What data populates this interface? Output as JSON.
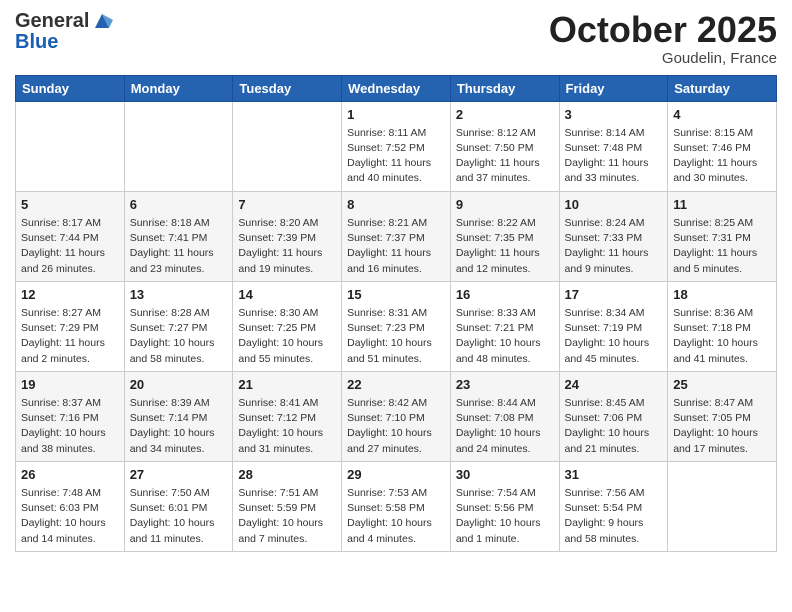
{
  "header": {
    "logo_general": "General",
    "logo_blue": "Blue",
    "month_title": "October 2025",
    "location": "Goudelin, France"
  },
  "days_of_week": [
    "Sunday",
    "Monday",
    "Tuesday",
    "Wednesday",
    "Thursday",
    "Friday",
    "Saturday"
  ],
  "weeks": [
    [
      {
        "day": "",
        "info": ""
      },
      {
        "day": "",
        "info": ""
      },
      {
        "day": "",
        "info": ""
      },
      {
        "day": "1",
        "info": "Sunrise: 8:11 AM\nSunset: 7:52 PM\nDaylight: 11 hours and 40 minutes."
      },
      {
        "day": "2",
        "info": "Sunrise: 8:12 AM\nSunset: 7:50 PM\nDaylight: 11 hours and 37 minutes."
      },
      {
        "day": "3",
        "info": "Sunrise: 8:14 AM\nSunset: 7:48 PM\nDaylight: 11 hours and 33 minutes."
      },
      {
        "day": "4",
        "info": "Sunrise: 8:15 AM\nSunset: 7:46 PM\nDaylight: 11 hours and 30 minutes."
      }
    ],
    [
      {
        "day": "5",
        "info": "Sunrise: 8:17 AM\nSunset: 7:44 PM\nDaylight: 11 hours and 26 minutes."
      },
      {
        "day": "6",
        "info": "Sunrise: 8:18 AM\nSunset: 7:41 PM\nDaylight: 11 hours and 23 minutes."
      },
      {
        "day": "7",
        "info": "Sunrise: 8:20 AM\nSunset: 7:39 PM\nDaylight: 11 hours and 19 minutes."
      },
      {
        "day": "8",
        "info": "Sunrise: 8:21 AM\nSunset: 7:37 PM\nDaylight: 11 hours and 16 minutes."
      },
      {
        "day": "9",
        "info": "Sunrise: 8:22 AM\nSunset: 7:35 PM\nDaylight: 11 hours and 12 minutes."
      },
      {
        "day": "10",
        "info": "Sunrise: 8:24 AM\nSunset: 7:33 PM\nDaylight: 11 hours and 9 minutes."
      },
      {
        "day": "11",
        "info": "Sunrise: 8:25 AM\nSunset: 7:31 PM\nDaylight: 11 hours and 5 minutes."
      }
    ],
    [
      {
        "day": "12",
        "info": "Sunrise: 8:27 AM\nSunset: 7:29 PM\nDaylight: 11 hours and 2 minutes."
      },
      {
        "day": "13",
        "info": "Sunrise: 8:28 AM\nSunset: 7:27 PM\nDaylight: 10 hours and 58 minutes."
      },
      {
        "day": "14",
        "info": "Sunrise: 8:30 AM\nSunset: 7:25 PM\nDaylight: 10 hours and 55 minutes."
      },
      {
        "day": "15",
        "info": "Sunrise: 8:31 AM\nSunset: 7:23 PM\nDaylight: 10 hours and 51 minutes."
      },
      {
        "day": "16",
        "info": "Sunrise: 8:33 AM\nSunset: 7:21 PM\nDaylight: 10 hours and 48 minutes."
      },
      {
        "day": "17",
        "info": "Sunrise: 8:34 AM\nSunset: 7:19 PM\nDaylight: 10 hours and 45 minutes."
      },
      {
        "day": "18",
        "info": "Sunrise: 8:36 AM\nSunset: 7:18 PM\nDaylight: 10 hours and 41 minutes."
      }
    ],
    [
      {
        "day": "19",
        "info": "Sunrise: 8:37 AM\nSunset: 7:16 PM\nDaylight: 10 hours and 38 minutes."
      },
      {
        "day": "20",
        "info": "Sunrise: 8:39 AM\nSunset: 7:14 PM\nDaylight: 10 hours and 34 minutes."
      },
      {
        "day": "21",
        "info": "Sunrise: 8:41 AM\nSunset: 7:12 PM\nDaylight: 10 hours and 31 minutes."
      },
      {
        "day": "22",
        "info": "Sunrise: 8:42 AM\nSunset: 7:10 PM\nDaylight: 10 hours and 27 minutes."
      },
      {
        "day": "23",
        "info": "Sunrise: 8:44 AM\nSunset: 7:08 PM\nDaylight: 10 hours and 24 minutes."
      },
      {
        "day": "24",
        "info": "Sunrise: 8:45 AM\nSunset: 7:06 PM\nDaylight: 10 hours and 21 minutes."
      },
      {
        "day": "25",
        "info": "Sunrise: 8:47 AM\nSunset: 7:05 PM\nDaylight: 10 hours and 17 minutes."
      }
    ],
    [
      {
        "day": "26",
        "info": "Sunrise: 7:48 AM\nSunset: 6:03 PM\nDaylight: 10 hours and 14 minutes."
      },
      {
        "day": "27",
        "info": "Sunrise: 7:50 AM\nSunset: 6:01 PM\nDaylight: 10 hours and 11 minutes."
      },
      {
        "day": "28",
        "info": "Sunrise: 7:51 AM\nSunset: 5:59 PM\nDaylight: 10 hours and 7 minutes."
      },
      {
        "day": "29",
        "info": "Sunrise: 7:53 AM\nSunset: 5:58 PM\nDaylight: 10 hours and 4 minutes."
      },
      {
        "day": "30",
        "info": "Sunrise: 7:54 AM\nSunset: 5:56 PM\nDaylight: 10 hours and 1 minute."
      },
      {
        "day": "31",
        "info": "Sunrise: 7:56 AM\nSunset: 5:54 PM\nDaylight: 9 hours and 58 minutes."
      },
      {
        "day": "",
        "info": ""
      }
    ]
  ]
}
